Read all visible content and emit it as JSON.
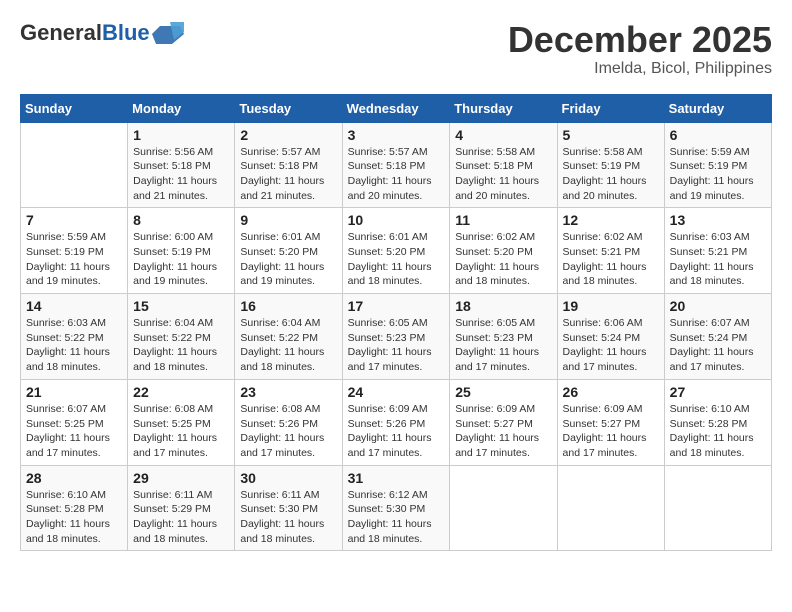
{
  "logo": {
    "general": "General",
    "blue": "Blue"
  },
  "title": {
    "month": "December 2025",
    "location": "Imelda, Bicol, Philippines"
  },
  "days_header": [
    "Sunday",
    "Monday",
    "Tuesday",
    "Wednesday",
    "Thursday",
    "Friday",
    "Saturday"
  ],
  "weeks": [
    [
      {
        "day": "",
        "info": ""
      },
      {
        "day": "1",
        "info": "Sunrise: 5:56 AM\nSunset: 5:18 PM\nDaylight: 11 hours\nand 21 minutes."
      },
      {
        "day": "2",
        "info": "Sunrise: 5:57 AM\nSunset: 5:18 PM\nDaylight: 11 hours\nand 21 minutes."
      },
      {
        "day": "3",
        "info": "Sunrise: 5:57 AM\nSunset: 5:18 PM\nDaylight: 11 hours\nand 20 minutes."
      },
      {
        "day": "4",
        "info": "Sunrise: 5:58 AM\nSunset: 5:18 PM\nDaylight: 11 hours\nand 20 minutes."
      },
      {
        "day": "5",
        "info": "Sunrise: 5:58 AM\nSunset: 5:19 PM\nDaylight: 11 hours\nand 20 minutes."
      },
      {
        "day": "6",
        "info": "Sunrise: 5:59 AM\nSunset: 5:19 PM\nDaylight: 11 hours\nand 19 minutes."
      }
    ],
    [
      {
        "day": "7",
        "info": "Sunrise: 5:59 AM\nSunset: 5:19 PM\nDaylight: 11 hours\nand 19 minutes."
      },
      {
        "day": "8",
        "info": "Sunrise: 6:00 AM\nSunset: 5:19 PM\nDaylight: 11 hours\nand 19 minutes."
      },
      {
        "day": "9",
        "info": "Sunrise: 6:01 AM\nSunset: 5:20 PM\nDaylight: 11 hours\nand 19 minutes."
      },
      {
        "day": "10",
        "info": "Sunrise: 6:01 AM\nSunset: 5:20 PM\nDaylight: 11 hours\nand 18 minutes."
      },
      {
        "day": "11",
        "info": "Sunrise: 6:02 AM\nSunset: 5:20 PM\nDaylight: 11 hours\nand 18 minutes."
      },
      {
        "day": "12",
        "info": "Sunrise: 6:02 AM\nSunset: 5:21 PM\nDaylight: 11 hours\nand 18 minutes."
      },
      {
        "day": "13",
        "info": "Sunrise: 6:03 AM\nSunset: 5:21 PM\nDaylight: 11 hours\nand 18 minutes."
      }
    ],
    [
      {
        "day": "14",
        "info": "Sunrise: 6:03 AM\nSunset: 5:22 PM\nDaylight: 11 hours\nand 18 minutes."
      },
      {
        "day": "15",
        "info": "Sunrise: 6:04 AM\nSunset: 5:22 PM\nDaylight: 11 hours\nand 18 minutes."
      },
      {
        "day": "16",
        "info": "Sunrise: 6:04 AM\nSunset: 5:22 PM\nDaylight: 11 hours\nand 18 minutes."
      },
      {
        "day": "17",
        "info": "Sunrise: 6:05 AM\nSunset: 5:23 PM\nDaylight: 11 hours\nand 17 minutes."
      },
      {
        "day": "18",
        "info": "Sunrise: 6:05 AM\nSunset: 5:23 PM\nDaylight: 11 hours\nand 17 minutes."
      },
      {
        "day": "19",
        "info": "Sunrise: 6:06 AM\nSunset: 5:24 PM\nDaylight: 11 hours\nand 17 minutes."
      },
      {
        "day": "20",
        "info": "Sunrise: 6:07 AM\nSunset: 5:24 PM\nDaylight: 11 hours\nand 17 minutes."
      }
    ],
    [
      {
        "day": "21",
        "info": "Sunrise: 6:07 AM\nSunset: 5:25 PM\nDaylight: 11 hours\nand 17 minutes."
      },
      {
        "day": "22",
        "info": "Sunrise: 6:08 AM\nSunset: 5:25 PM\nDaylight: 11 hours\nand 17 minutes."
      },
      {
        "day": "23",
        "info": "Sunrise: 6:08 AM\nSunset: 5:26 PM\nDaylight: 11 hours\nand 17 minutes."
      },
      {
        "day": "24",
        "info": "Sunrise: 6:09 AM\nSunset: 5:26 PM\nDaylight: 11 hours\nand 17 minutes."
      },
      {
        "day": "25",
        "info": "Sunrise: 6:09 AM\nSunset: 5:27 PM\nDaylight: 11 hours\nand 17 minutes."
      },
      {
        "day": "26",
        "info": "Sunrise: 6:09 AM\nSunset: 5:27 PM\nDaylight: 11 hours\nand 17 minutes."
      },
      {
        "day": "27",
        "info": "Sunrise: 6:10 AM\nSunset: 5:28 PM\nDaylight: 11 hours\nand 18 minutes."
      }
    ],
    [
      {
        "day": "28",
        "info": "Sunrise: 6:10 AM\nSunset: 5:28 PM\nDaylight: 11 hours\nand 18 minutes."
      },
      {
        "day": "29",
        "info": "Sunrise: 6:11 AM\nSunset: 5:29 PM\nDaylight: 11 hours\nand 18 minutes."
      },
      {
        "day": "30",
        "info": "Sunrise: 6:11 AM\nSunset: 5:30 PM\nDaylight: 11 hours\nand 18 minutes."
      },
      {
        "day": "31",
        "info": "Sunrise: 6:12 AM\nSunset: 5:30 PM\nDaylight: 11 hours\nand 18 minutes."
      },
      {
        "day": "",
        "info": ""
      },
      {
        "day": "",
        "info": ""
      },
      {
        "day": "",
        "info": ""
      }
    ]
  ]
}
